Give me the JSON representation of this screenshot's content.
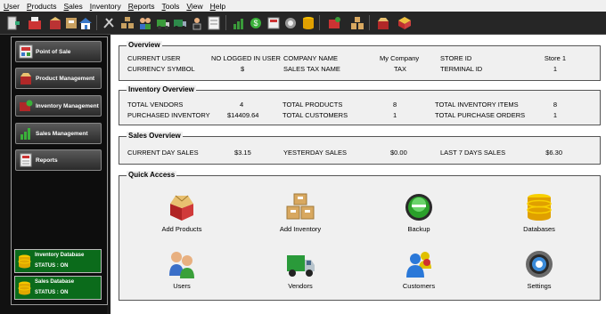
{
  "menu": [
    "User",
    "Products",
    "Sales",
    "Inventory",
    "Reports",
    "Tools",
    "View",
    "Help"
  ],
  "nav": [
    {
      "label": "Point of Sale",
      "icon": "point-of-sale-icon"
    },
    {
      "label": "Product Management",
      "icon": "product-management-icon"
    },
    {
      "label": "Inventory Management",
      "icon": "inventory-management-icon"
    },
    {
      "label": "Sales Management",
      "icon": "sales-management-icon"
    },
    {
      "label": "Reports",
      "icon": "reports-icon"
    }
  ],
  "databases": [
    {
      "name": "Inventory Database",
      "status": "STATUS : ON"
    },
    {
      "name": "Sales Database",
      "status": "STATUS : ON"
    }
  ],
  "overview": {
    "title": "Overview",
    "current_user_label": "CURRENT USER",
    "current_user_value": "NO LOGGED IN USER",
    "company_label": "COMPANY NAME",
    "company_value": "My Company",
    "store_label": "STORE ID",
    "store_value": "Store 1",
    "currency_label": "CURRENCY SYMBOL",
    "currency_value": "$",
    "tax_label": "SALES TAX NAME",
    "tax_value": "TAX",
    "terminal_label": "TERMINAL ID",
    "terminal_value": "1"
  },
  "inventory": {
    "title": "Inventory Overview",
    "vendors_label": "TOTAL VENDORS",
    "vendors_value": "4",
    "products_label": "TOTAL PRODUCTS",
    "products_value": "8",
    "items_label": "TOTAL INVENTORY ITEMS",
    "items_value": "8",
    "purchased_label": "PURCHASED INVENTORY",
    "purchased_value": "$14409.64",
    "customers_label": "TOTAL CUSTOMERS",
    "customers_value": "1",
    "orders_label": "TOTAL PURCHASE ORDERS",
    "orders_value": "1"
  },
  "sales": {
    "title": "Sales Overview",
    "today_label": "CURRENT DAY SALES",
    "today_value": "$3.15",
    "yesterday_label": "YESTERDAY SALES",
    "yesterday_value": "$0.00",
    "week_label": "LAST 7 DAYS SALES",
    "week_value": "$6.30"
  },
  "quick": {
    "title": "Quick Access",
    "items": [
      {
        "label": "Add Products",
        "icon": "add-products-icon"
      },
      {
        "label": "Add Inventory",
        "icon": "add-inventory-icon"
      },
      {
        "label": "Backup",
        "icon": "backup-icon"
      },
      {
        "label": "Databases",
        "icon": "databases-icon"
      },
      {
        "label": "Users",
        "icon": "users-icon"
      },
      {
        "label": "Vendors",
        "icon": "vendors-icon"
      },
      {
        "label": "Customers",
        "icon": "customers-icon"
      },
      {
        "label": "Settings",
        "icon": "settings-icon"
      }
    ]
  },
  "colors": {
    "db_green": "#0b6b1b",
    "toolbar": "#262626",
    "panel": "#f0f0f0"
  }
}
